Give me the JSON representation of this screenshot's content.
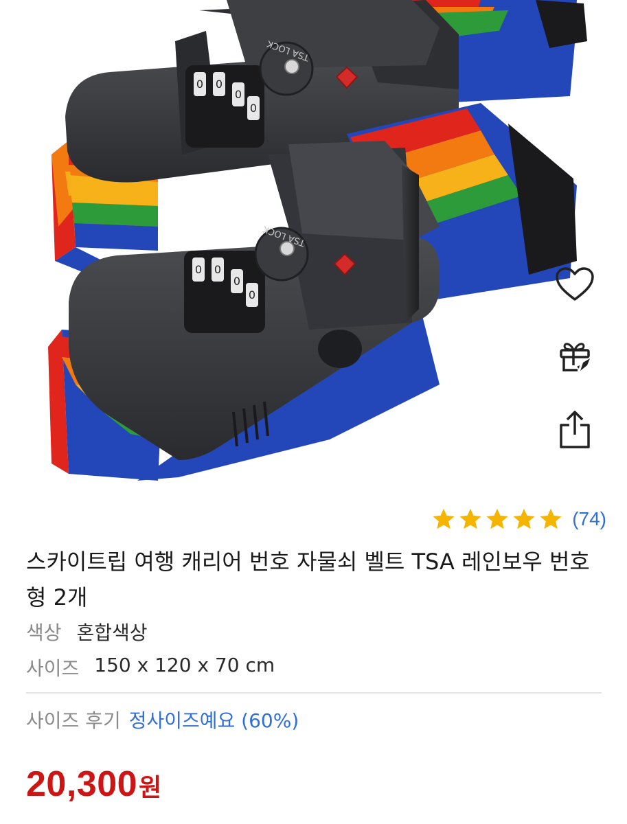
{
  "product": {
    "title": "스카이트립 여행 캐리어 번호 자물쇠 벨트 TSA 레인보우 번호형 2개",
    "image_alt": "TSA LOCK",
    "rating": {
      "stars": 5,
      "review_count": "(74)"
    },
    "options": [
      {
        "label": "색상",
        "value": "혼합색상"
      },
      {
        "label": "사이즈",
        "value": "150 x 120 x 70 cm"
      }
    ],
    "size_review": {
      "label": "사이즈 후기",
      "value": "정사이즈예요 (60%)"
    },
    "price": {
      "amount": "20,300",
      "unit": "원"
    }
  },
  "actions": {
    "like_icon": "heart-icon",
    "gift_icon": "gift-icon",
    "share_icon": "share-icon"
  },
  "colors": {
    "star": "#f5b400",
    "link": "#2f6fd6",
    "price": "#cc1515",
    "rainbow": [
      "#e0251c",
      "#f27a10",
      "#f7b21a",
      "#2e9b3a",
      "#2346b8"
    ]
  }
}
